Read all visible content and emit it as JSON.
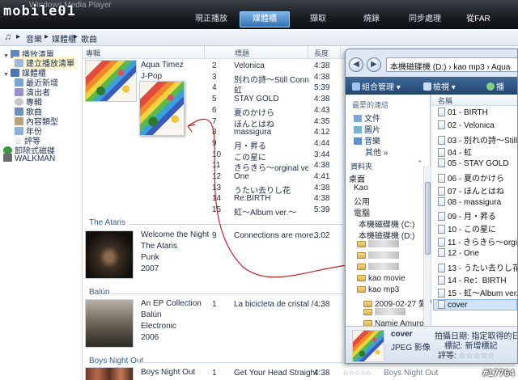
{
  "window": {
    "title": "Windows Media Player",
    "logo_text": "mobile01"
  },
  "tabs": [
    {
      "label": "現正播放"
    },
    {
      "label": "媒體櫃"
    },
    {
      "label": "擷取"
    },
    {
      "label": "燒錄"
    },
    {
      "label": "同步處理"
    },
    {
      "label": "從FAR"
    }
  ],
  "breadcrumb": [
    "音樂",
    "媒體櫃",
    "歌曲"
  ],
  "nav": {
    "playlists": "播放清單",
    "create_playlist": "建立播放清單",
    "library": "媒體櫃",
    "items": [
      "最近新增",
      "演出者",
      "專輯",
      "歌曲",
      "內容類型",
      "年份",
      "評等"
    ],
    "portable": "卸除式磁碟",
    "walkman": "WALKMAN"
  },
  "columns": {
    "album": "專輯",
    "title": "標題",
    "length": "長度"
  },
  "albums": [
    {
      "artist": "Aqua Timez",
      "genre": "J-Pop",
      "tracks": [
        {
          "no": "2",
          "title": "Velonica",
          "length": "4:38"
        },
        {
          "no": "3",
          "title": "別れの詩～Still Connec...",
          "length": "4:38"
        },
        {
          "no": "4",
          "title": "虹",
          "length": "5:39"
        },
        {
          "no": "5",
          "title": "STAY GOLD",
          "length": "4:38"
        },
        {
          "no": "6",
          "title": "夏のかけら",
          "length": "4:43"
        },
        {
          "no": "7",
          "title": "ほんとはね",
          "length": "4:35"
        },
        {
          "no": "8",
          "title": "massigura",
          "length": "4:12"
        },
        {
          "no": "9",
          "title": "月・昇る",
          "length": "4:44"
        },
        {
          "no": "10",
          "title": "この星に",
          "length": "3:44"
        },
        {
          "no": "11",
          "title": "きらきら～orginal ver.～",
          "length": "4:38"
        },
        {
          "no": "12",
          "title": "One",
          "length": "4:41"
        },
        {
          "no": "13",
          "title": "うたい去りし花",
          "length": "4:38"
        },
        {
          "no": "14",
          "title": "Re:BIRTH",
          "length": "4:38"
        },
        {
          "no": "15",
          "title": "虹～Album ver.～",
          "length": "5:39"
        }
      ]
    },
    {
      "group": "The Ataris",
      "album": "Welcome the Night",
      "artist": "The Ataris",
      "genre": "Punk",
      "year": "2007",
      "tracks": [
        {
          "no": "9",
          "title": "Connections are more...",
          "length": "3:02"
        }
      ]
    },
    {
      "group": "Balún",
      "album": "An EP Collection",
      "artist": "Balún",
      "genre": "Electronic",
      "year": "2006",
      "tracks": [
        {
          "no": "1",
          "title": "La bicicleta de cristal / ...",
          "length": "4:38"
        }
      ]
    },
    {
      "group": "Boys Night Out",
      "album": "Boys Night Out",
      "tracks": [
        {
          "no": "1",
          "title": "Get Your Head Straight",
          "length": "4:38"
        }
      ],
      "artist_col": "Boys Night Out"
    }
  ],
  "explorer": {
    "address": "本機磁碟機 (D:)  ›  kao mp3  ›  Aqua",
    "toolbar": [
      "組合管理 ▾",
      "檢視 ▾",
      "播"
    ],
    "fav_header": "最愛的連結",
    "favorites": [
      "文件",
      "圖片",
      "音樂",
      "其他 »"
    ],
    "folders_header": "資料夾",
    "tree": [
      "桌面",
      "Kao",
      "公用",
      "電腦",
      "本機磁碟機 (C:)",
      "本機磁碟機 (D:)",
      "kao movie",
      "kao mp3",
      "2009-02-27 愛的...",
      "Namie Amuro - 8..."
    ],
    "name_header": "名稱",
    "files": [
      "01 - BIRTH",
      "02 - Velonica",
      "03 - 別れの詩～Still Con",
      "04 - 虹",
      "05 - STAY GOLD",
      "06 - 夏のかけら",
      "07 - ほんとはね",
      "08 - massigura",
      "09 - 月・昇る",
      "10 - この星に",
      "11 - きらきら～orginal",
      "12 - One",
      "13 - うたい去りし花",
      "14 - Re：BIRTH",
      "15 - 虹～Album ver.～",
      "cover"
    ],
    "detail_name": "cover",
    "detail_type": "JPEG 影像",
    "detail_date": "拍攝日期: 指定取得的日期及時間",
    "detail_tag": "標記: 新增標記",
    "detail_rating": "評等:"
  },
  "watermark": "#17764"
}
